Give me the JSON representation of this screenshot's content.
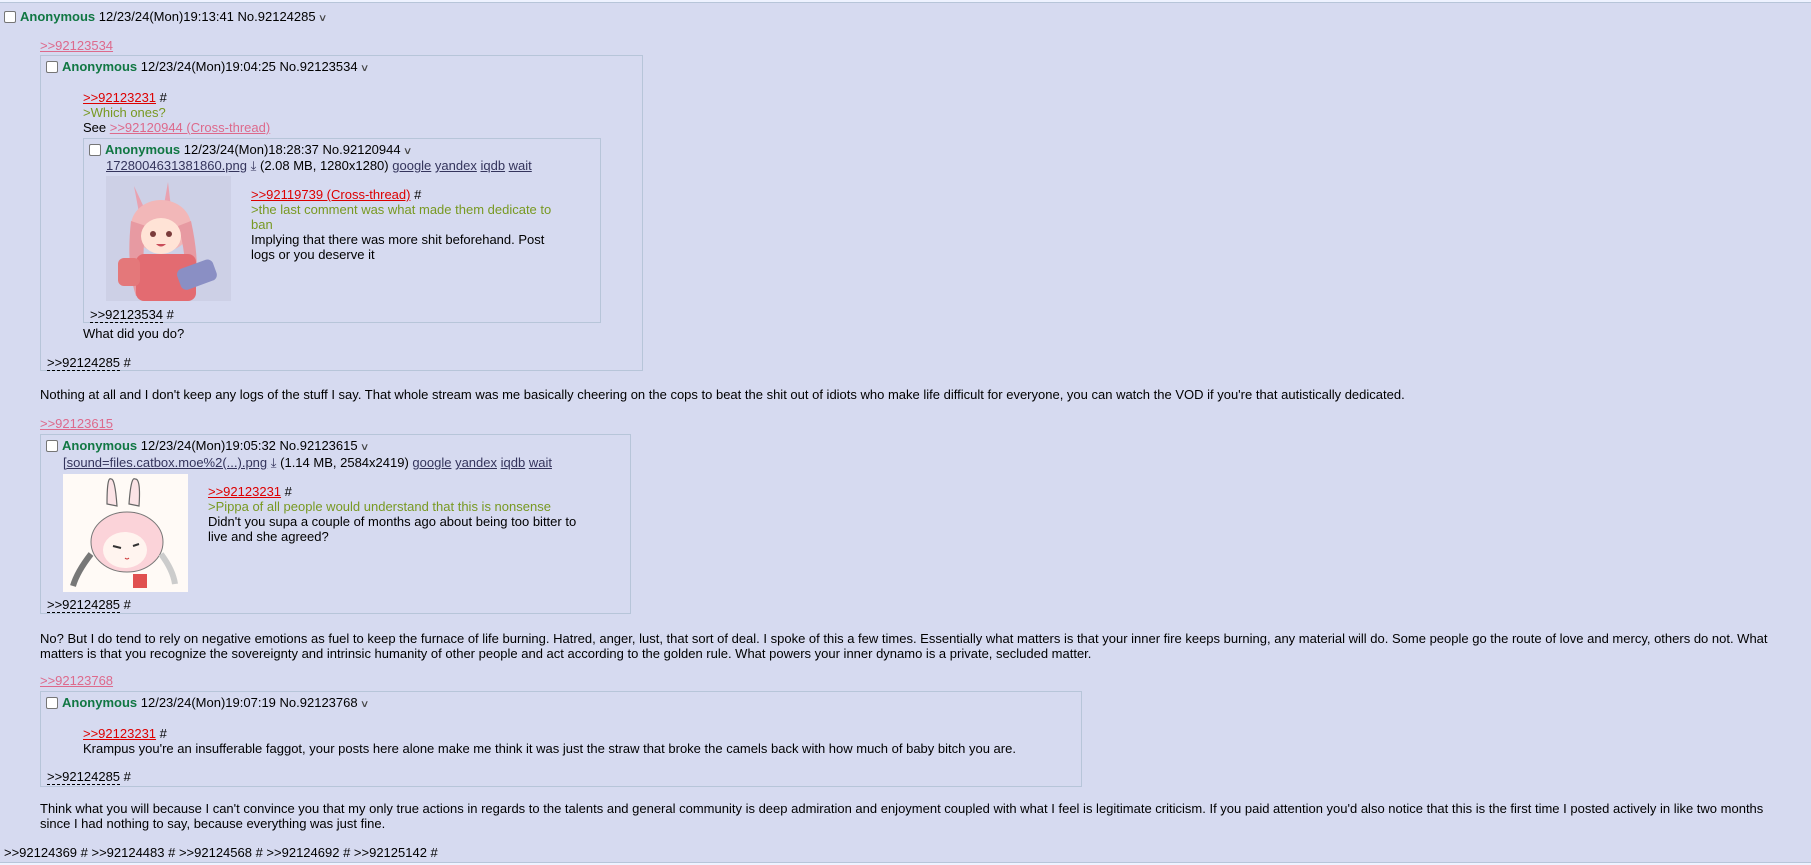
{
  "main": {
    "name": "Anonymous",
    "datetime": "12/23/24(Mon)19:13:41",
    "no": "No.92124285"
  },
  "q1": {
    "backlink": ">>92123534",
    "name": "Anonymous",
    "datetime": "12/23/24(Mon)19:04:25",
    "no": "No.92123534",
    "quote": ">>92123231",
    "hash": "#",
    "green": ">Which ones?",
    "see": "See ",
    "see_link": ">>92120944 (Cross-thread)",
    "after": "What did you do?",
    "footer_ref": ">>92124285",
    "footer_hash": "#"
  },
  "q1b": {
    "name": "Anonymous",
    "datetime": "12/23/24(Mon)18:28:37",
    "no": "No.92120944",
    "filename": "1728004631381860.png",
    "fileinfo": "(2.08 MB, 1280x1280)",
    "google": "google",
    "yandex": "yandex",
    "iqdb": "iqdb",
    "wait": "wait",
    "quote": ">>92119739 (Cross-thread)",
    "hash": "#",
    "green": ">the last comment was what made them dedicate to ban",
    "body": "Implying that there was more shit beforehand. Post logs or you deserve it",
    "footer_ref": ">>92123534",
    "footer_hash": "#"
  },
  "reply1": "Nothing at all and I don't keep any logs of the stuff I say. That whole stream was me basically cheering on the cops to beat the shit out of idiots who make life difficult for everyone, you can watch the VOD if you're that autistically dedicated.",
  "q2": {
    "backlink": ">>92123615",
    "name": "Anonymous",
    "datetime": "12/23/24(Mon)19:05:32",
    "no": "No.92123615",
    "filename": "[sound=files.catbox.moe%2(...).png",
    "fileinfo": "(1.14 MB, 2584x2419)",
    "google": "google",
    "yandex": "yandex",
    "iqdb": "iqdb",
    "wait": "wait",
    "quote": ">>92123231",
    "hash": "#",
    "green": ">Pippa of all people would understand that this is nonsense",
    "body": "Didn't you supa a couple of months ago about being too bitter to live and she agreed?",
    "footer_ref": ">>92124285",
    "footer_hash": "#"
  },
  "reply2": "No? But I do tend to rely on negative emotions as fuel to keep the furnace of life burning. Hatred, anger, lust, that sort of deal. I spoke of this a few times. Essentially what matters is that your inner fire keeps burning, any material will do. Some people go the route of love and mercy, others do not. What matters is that you recognize the sovereignty and intrinsic humanity of other people and act according to the golden rule. What powers your inner dynamo is a private, secluded matter.",
  "q3": {
    "backlink": ">>92123768",
    "name": "Anonymous",
    "datetime": "12/23/24(Mon)19:07:19",
    "no": "No.92123768",
    "quote": ">>92123231",
    "hash": "#",
    "body": "Krampus you're an insufferable faggot, your posts here alone make me think it was just the straw that broke the camels back with how much of baby bitch you are.",
    "footer_ref": ">>92124285",
    "footer_hash": "#"
  },
  "reply3": "Think what you will because I can't convince you that my only true actions in regards to the talents and general community is deep admiration and enjoyment coupled with what I feel is legitimate criticism. If you paid attention you'd also notice that this is the first time I posted actively in like two months since I had nothing to say, because everything was just fine.",
  "footer_refs": ">>92124369 # >>92124483 # >>92124568 # >>92124692 # >>92125142 #",
  "icons": [
    "checkbox-icon",
    "chevron-down-icon",
    "download-icon"
  ]
}
